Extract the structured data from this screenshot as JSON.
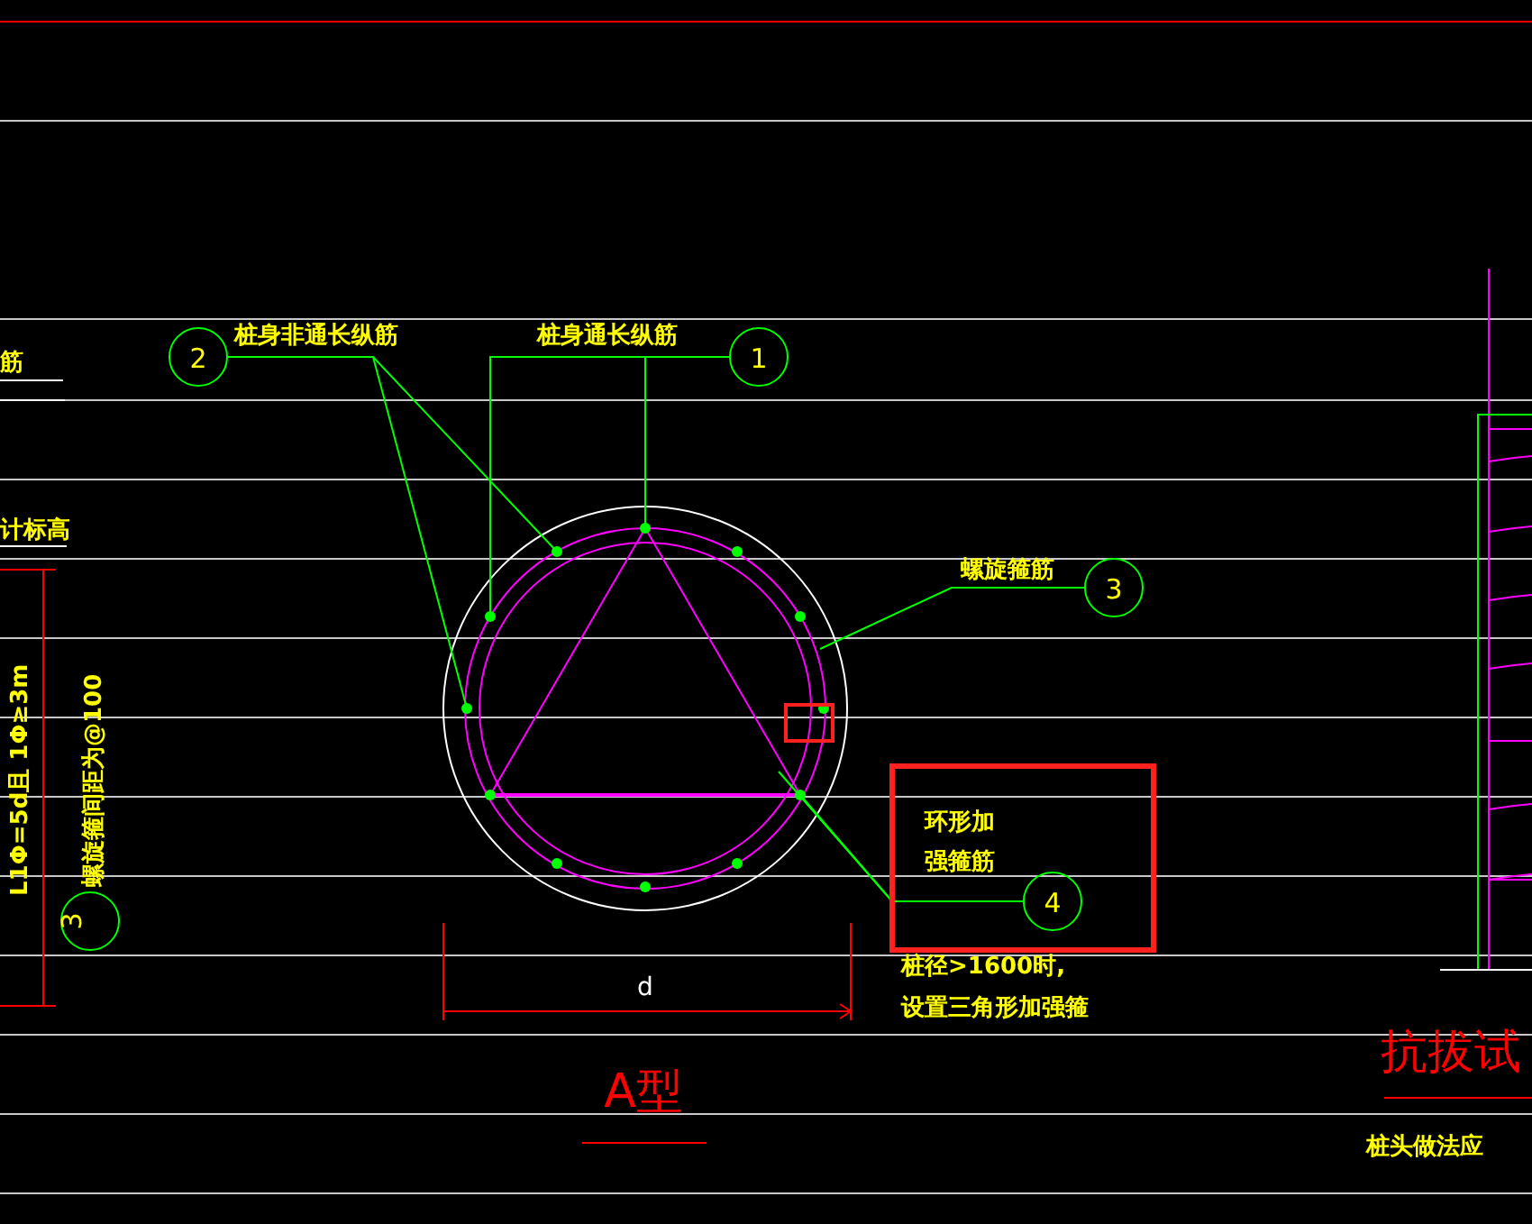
{
  "drawing": {
    "callouts": [
      {
        "number": "2",
        "label": "桩身非通长纵筋"
      },
      {
        "number": "1",
        "label": "桩身通长纵筋"
      },
      {
        "number": "3",
        "label": "螺旋箍筋"
      },
      {
        "number": "4",
        "label": "环形加"
      }
    ],
    "ring_label_second_line": "强箍筋",
    "note_lines": [
      "桩径>1600时,",
      "设置三角形加强箍"
    ],
    "dimension": "d",
    "section_title": "A型",
    "left_texts": [
      "筋",
      "计标高"
    ],
    "left_vertical": {
      "length_note": "L1Φ=5d且 1Φ≥3m",
      "spacing_note": "螺旋箍间距为@100",
      "callout_number": "3"
    },
    "right_title": "抗拔试",
    "right_note": "桩头做法应"
  }
}
